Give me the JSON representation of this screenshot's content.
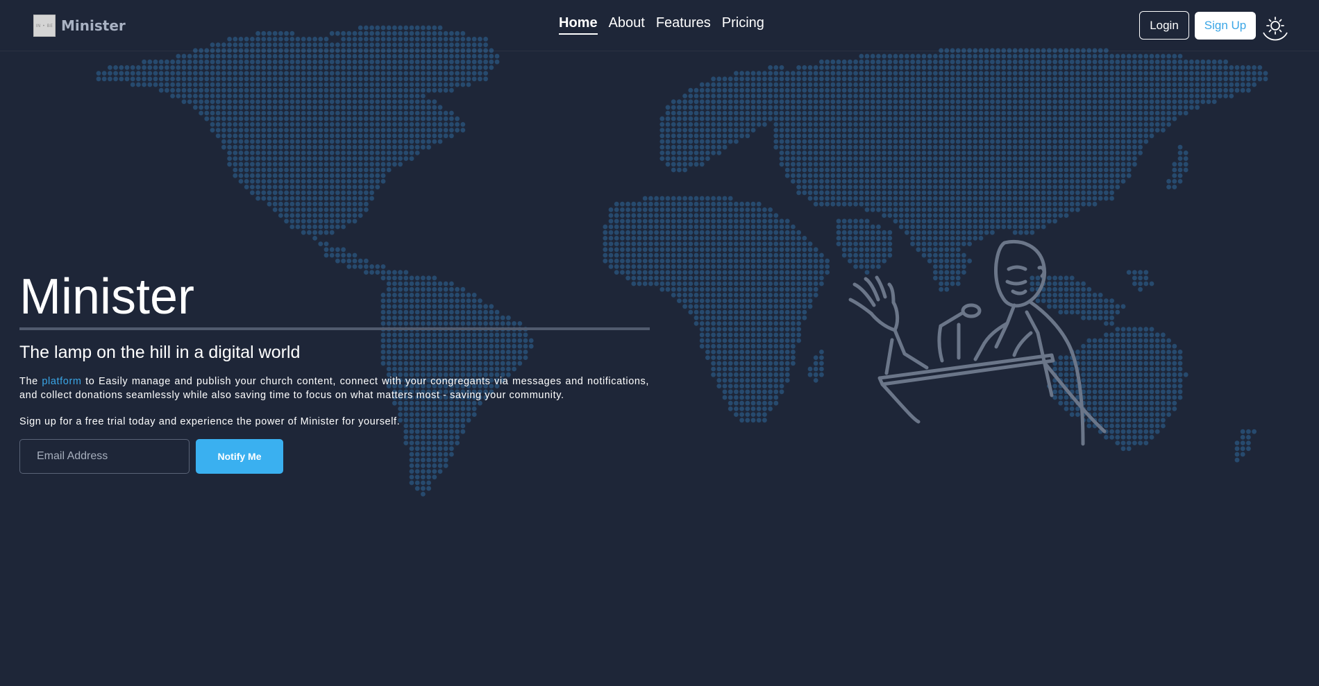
{
  "brand": {
    "logo_text": "IN • BE",
    "name": "Minister"
  },
  "nav": {
    "items": [
      {
        "label": "Home",
        "active": true
      },
      {
        "label": "About",
        "active": false
      },
      {
        "label": "Features",
        "active": false
      },
      {
        "label": "Pricing",
        "active": false
      }
    ]
  },
  "auth": {
    "login_label": "Login",
    "signup_label": "Sign Up"
  },
  "theme_toggle_icon": "sun-icon",
  "hero": {
    "title": "Minister",
    "subtitle": "The lamp on the hill in a digital world",
    "desc_prefix": "The ",
    "desc_link": "platform",
    "desc_rest": " to Easily manage and publish your church content, connect with your congregants via messages and notifications, and collect donations seamlessly while also saving time to focus on what matters most - saving your community.",
    "cta": "Sign up for a free trial today and experience the power of Minister for yourself.",
    "email_placeholder": "Email Address",
    "email_value": "",
    "notify_label": "Notify Me"
  },
  "colors": {
    "background": "#1e2638",
    "accent": "#3aa6e6",
    "map_dots": "#274a6e",
    "illustration_stroke": "#6b7689"
  },
  "decor": {
    "background_icon": "world-map-dots",
    "illustration_icon": "preacher-at-pulpit"
  }
}
